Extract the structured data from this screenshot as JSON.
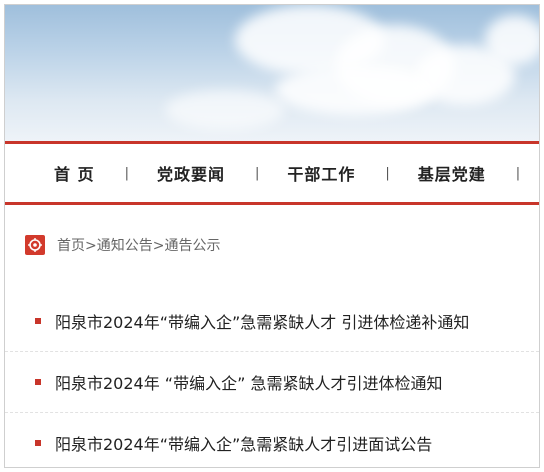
{
  "nav": {
    "items": [
      "首 页",
      "党政要闻",
      "干部工作",
      "基层党建"
    ],
    "separator": "|"
  },
  "breadcrumb": {
    "text": "首页>通知公告>通告公示"
  },
  "list": [
    "阳泉市2024年“带编入企”急需紧缺人才 引进体检递补通知",
    "阳泉市2024年 “带编入企” 急需紧缺人才引进体检通知",
    "阳泉市2024年“带编入企”急需紧缺人才引进面试公告"
  ],
  "colors": {
    "accent": "#c8352a"
  }
}
